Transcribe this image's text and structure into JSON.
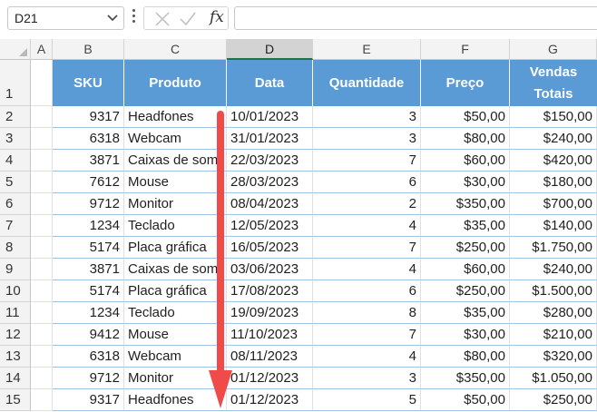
{
  "name_box": {
    "value": "D21"
  },
  "formula_bar": {
    "fx_label": "fx",
    "value": ""
  },
  "columns": [
    "A",
    "B",
    "C",
    "D",
    "E",
    "F",
    "G"
  ],
  "selected_column": "D",
  "rows": [
    "1",
    "2",
    "3",
    "4",
    "5",
    "6",
    "7",
    "8",
    "9",
    "10",
    "11",
    "12",
    "13",
    "14",
    "15"
  ],
  "table": {
    "headers": {
      "sku": "SKU",
      "produto": "Produto",
      "data": "Data",
      "quantidade": "Quantidade",
      "preco": "Preço",
      "vendas_line1": "Vendas",
      "vendas_line2": "Totais"
    },
    "rows": [
      {
        "sku": "9317",
        "produto": "Headfones",
        "data": "10/01/2023",
        "quantidade": "3",
        "preco": "$50,00",
        "vendas": "$150,00"
      },
      {
        "sku": "6318",
        "produto": "Webcam",
        "data": "31/01/2023",
        "quantidade": "3",
        "preco": "$80,00",
        "vendas": "$240,00"
      },
      {
        "sku": "3871",
        "produto": "Caixas de som",
        "data": "22/03/2023",
        "quantidade": "7",
        "preco": "$60,00",
        "vendas": "$420,00"
      },
      {
        "sku": "7612",
        "produto": "Mouse",
        "data": "28/03/2023",
        "quantidade": "6",
        "preco": "$30,00",
        "vendas": "$180,00"
      },
      {
        "sku": "9712",
        "produto": "Monitor",
        "data": "08/04/2023",
        "quantidade": "2",
        "preco": "$350,00",
        "vendas": "$700,00"
      },
      {
        "sku": "1234",
        "produto": "Teclado",
        "data": "12/05/2023",
        "quantidade": "4",
        "preco": "$35,00",
        "vendas": "$140,00"
      },
      {
        "sku": "5174",
        "produto": "Placa gráfica",
        "data": "16/05/2023",
        "quantidade": "7",
        "preco": "$250,00",
        "vendas": "$1.750,00"
      },
      {
        "sku": "3871",
        "produto": "Caixas de som",
        "data": "03/06/2023",
        "quantidade": "4",
        "preco": "$60,00",
        "vendas": "$240,00"
      },
      {
        "sku": "5174",
        "produto": "Placa gráfica",
        "data": "17/08/2023",
        "quantidade": "6",
        "preco": "$250,00",
        "vendas": "$1.500,00"
      },
      {
        "sku": "1234",
        "produto": "Teclado",
        "data": "19/09/2023",
        "quantidade": "8",
        "preco": "$35,00",
        "vendas": "$280,00"
      },
      {
        "sku": "9412",
        "produto": "Mouse",
        "data": "11/10/2023",
        "quantidade": "7",
        "preco": "$30,00",
        "vendas": "$210,00"
      },
      {
        "sku": "6318",
        "produto": "Webcam",
        "data": "08/11/2023",
        "quantidade": "4",
        "preco": "$80,00",
        "vendas": "$320,00"
      },
      {
        "sku": "9712",
        "produto": "Monitor",
        "data": "01/12/2023",
        "quantidade": "3",
        "preco": "$350,00",
        "vendas": "$1.050,00"
      },
      {
        "sku": "9317",
        "produto": "Headfones",
        "data": "01/12/2023",
        "quantidade": "5",
        "preco": "$50,00",
        "vendas": "$250,00"
      }
    ]
  },
  "annotation": {
    "arrow_color": "#f04b4b",
    "arrow_direction": "down"
  },
  "colors": {
    "header_fill": "#5b9bd5",
    "row_border": "#9dc3e6",
    "selected_column_accent": "#217346"
  }
}
